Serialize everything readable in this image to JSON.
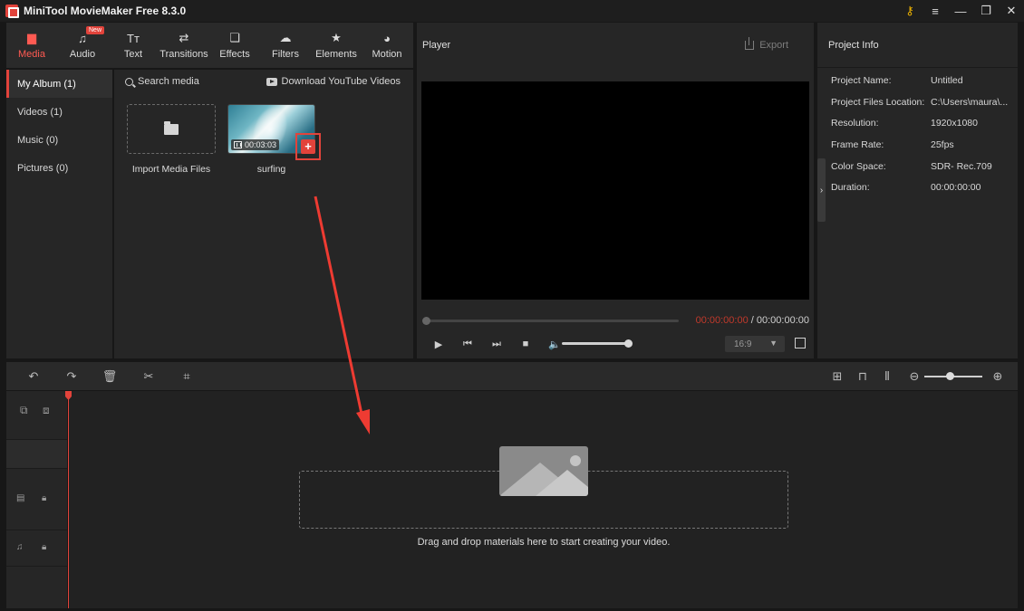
{
  "window": {
    "title": "MiniTool MovieMaker Free 8.3.0",
    "controls": [
      "key-icon",
      "menu-icon",
      "minimize-icon",
      "maximize-icon",
      "close-icon"
    ]
  },
  "tools": {
    "items": [
      {
        "label": "Media",
        "icon": "media-folder-icon",
        "active": true
      },
      {
        "label": "Audio",
        "icon": "music-note-icon",
        "badge": "New"
      },
      {
        "label": "Text",
        "icon": "text-icon"
      },
      {
        "label": "Transitions",
        "icon": "transitions-icon"
      },
      {
        "label": "Effects",
        "icon": "effects-icon"
      },
      {
        "label": "Filters",
        "icon": "filters-icon"
      },
      {
        "label": "Elements",
        "icon": "elements-icon"
      },
      {
        "label": "Motion",
        "icon": "motion-icon"
      }
    ]
  },
  "album": {
    "items": [
      {
        "label": "My Album (1)",
        "active": true
      },
      {
        "label": "Videos (1)"
      },
      {
        "label": "Music (0)"
      },
      {
        "label": "Pictures (0)"
      }
    ]
  },
  "media": {
    "search_label": "Search media",
    "youtube_label": "Download YouTube Videos",
    "import_label": "Import Media Files",
    "clip": {
      "name": "surfing",
      "duration": "00:03:03",
      "add_symbol": "+"
    }
  },
  "player": {
    "title": "Player",
    "export_label": "Export",
    "current_time": "00:00:00:00",
    "separator": " / ",
    "total_time": "00:00:00:00",
    "aspect_ratio": "16:9",
    "progress": 0,
    "volume": 1.0
  },
  "project_info": {
    "title": "Project Info",
    "rows": [
      {
        "label": "Project Name:",
        "value": "Untitled"
      },
      {
        "label": "Project Files Location:",
        "value": "C:\\Users\\maura\\..."
      },
      {
        "label": "Resolution:",
        "value": "1920x1080"
      },
      {
        "label": "Frame Rate:",
        "value": "25fps"
      },
      {
        "label": "Color Space:",
        "value": "SDR- Rec.709"
      },
      {
        "label": "Duration:",
        "value": "00:00:00:00"
      }
    ]
  },
  "timeline": {
    "drop_text": "Drag and drop materials here to start creating your video.",
    "toolbar_left": [
      "undo-icon",
      "redo-icon",
      "delete-icon",
      "split-icon",
      "crop-icon"
    ],
    "toolbar_right": [
      "fit-timeline-icon",
      "magnet-icon",
      "audio-split-icon",
      "zoom-out-icon",
      "zoom-in-icon"
    ]
  },
  "colors": {
    "accent": "#e2433b",
    "panel": "#262626",
    "background": "#171717"
  }
}
